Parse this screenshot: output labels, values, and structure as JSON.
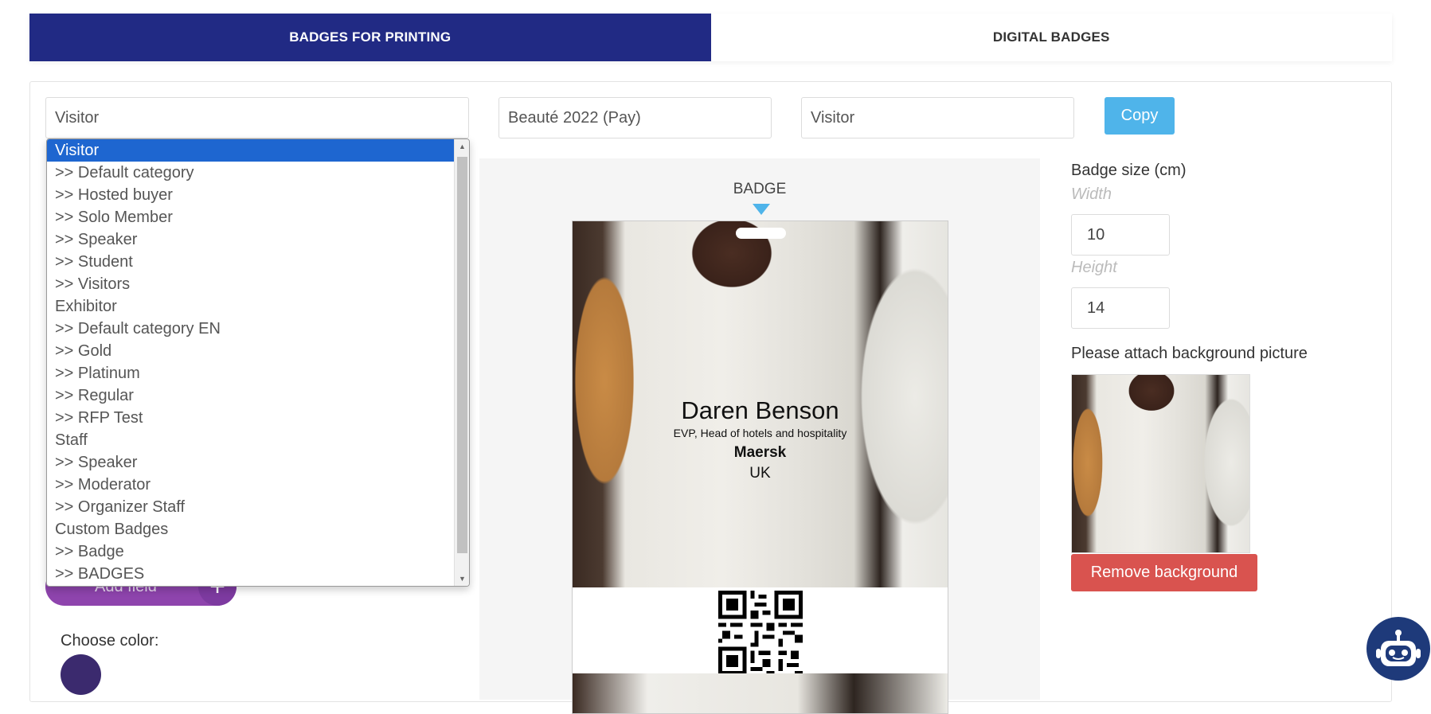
{
  "tabs": [
    {
      "label": "BADGES FOR PRINTING",
      "active": true
    },
    {
      "label": "DIGITAL BADGES",
      "active": false
    }
  ],
  "selects": {
    "category": "Visitor",
    "event": "Beauté 2022 (Pay)",
    "target_category": "Visitor"
  },
  "copy_label": "Copy",
  "category_options": [
    {
      "label": "Visitor",
      "selected": true
    },
    {
      "label": ">> Default category"
    },
    {
      "label": ">> Hosted buyer"
    },
    {
      "label": ">> Solo Member"
    },
    {
      "label": ">> Speaker"
    },
    {
      "label": ">> Student"
    },
    {
      "label": ">> Visitors"
    },
    {
      "label": "Exhibitor"
    },
    {
      "label": ">> Default category EN"
    },
    {
      "label": ">> Gold"
    },
    {
      "label": ">> Platinum"
    },
    {
      "label": ">> Regular"
    },
    {
      "label": ">> RFP Test"
    },
    {
      "label": "Staff"
    },
    {
      "label": ">> Speaker"
    },
    {
      "label": ">> Moderator"
    },
    {
      "label": ">> Organizer Staff"
    },
    {
      "label": "Custom Badges"
    },
    {
      "label": ">> Badge"
    },
    {
      "label": ">> BADGES"
    }
  ],
  "add_field_label": "Add field",
  "color_label": "Choose color:",
  "colors": {
    "accent": "#212a84",
    "swatch": "#3b2a6e",
    "copy": "#4fb4ea",
    "remove": "#d9534f",
    "add_field": "#8e44ad"
  },
  "badge": {
    "label": "BADGE",
    "name": "Daren Benson",
    "title": "EVP, Head of hotels and hospitality",
    "company": "Maersk",
    "country": "UK"
  },
  "size": {
    "title": "Badge size (cm)",
    "width_label": "Width",
    "width": "10",
    "height_label": "Height",
    "height": "14"
  },
  "attach_label": "Please attach background picture",
  "remove_label": "Remove background"
}
